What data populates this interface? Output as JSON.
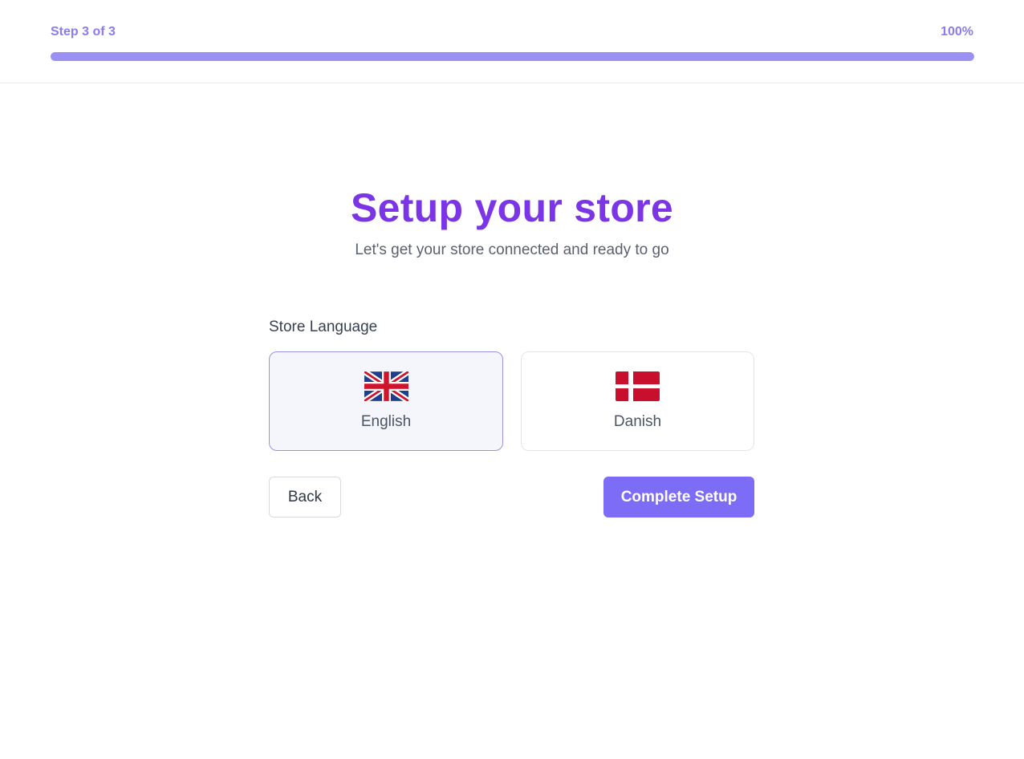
{
  "progress": {
    "step_label": "Step 3 of 3",
    "percent_label": "100%",
    "value": 1.0
  },
  "heading": {
    "title": "Setup your store",
    "subtitle": "Let's get your store connected and ready to go"
  },
  "language": {
    "label": "Store Language",
    "options": [
      {
        "name": "English",
        "flag": "uk-flag-icon",
        "selected": true
      },
      {
        "name": "Danish",
        "flag": "denmark-flag-icon",
        "selected": false
      }
    ]
  },
  "actions": {
    "back_label": "Back",
    "complete_label": "Complete Setup"
  },
  "colors": {
    "accent": "#7d6cf6",
    "title": "#7b35e6",
    "progress_fill": "#9b90f4"
  }
}
